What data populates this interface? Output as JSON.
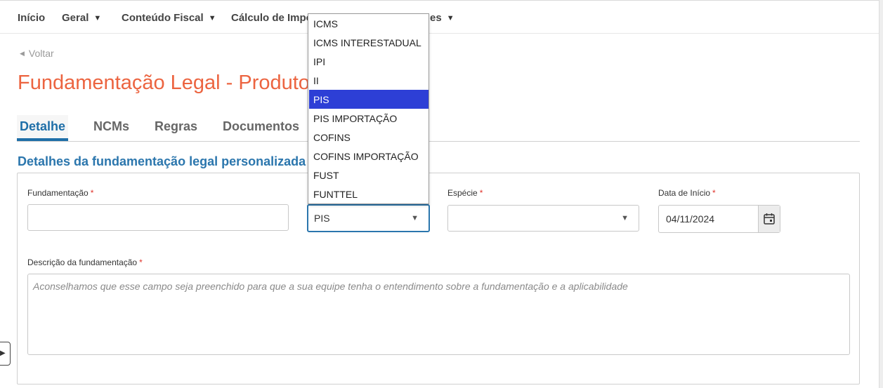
{
  "nav": {
    "items": [
      {
        "label": "Início",
        "caret": false
      },
      {
        "label": "Geral",
        "caret": true
      },
      {
        "label": "Conteúdo Fiscal",
        "caret": true
      },
      {
        "label": "Cálculo de Impos",
        "caret": false
      },
      {
        "label": "es",
        "caret": true
      }
    ]
  },
  "back": {
    "label": "Voltar"
  },
  "page": {
    "title": "Fundamentação Legal - Produto"
  },
  "tabs": [
    {
      "label": "Detalhe",
      "active": true
    },
    {
      "label": "NCMs",
      "active": false
    },
    {
      "label": "Regras",
      "active": false
    },
    {
      "label": "Documentos",
      "active": false
    }
  ],
  "section": {
    "title": "Detalhes da fundamentação legal personalizada"
  },
  "form": {
    "fundamentacao": {
      "label": "Fundamentação",
      "required": "*",
      "value": ""
    },
    "tributo": {
      "value": "PIS"
    },
    "especie": {
      "label": "Espécie",
      "required": "*",
      "value": ""
    },
    "data_inicio": {
      "label": "Data de Início",
      "required": "*",
      "value": "04/11/2024"
    },
    "descricao": {
      "label": "Descrição da fundamentação",
      "required": "*",
      "placeholder": "Aconselhamos que esse campo seja preenchido para que a sua equipe tenha o entendimento sobre a fundamentação e a aplicabilidade"
    }
  },
  "dropdown": {
    "options": [
      "ICMS",
      "ICMS INTERESTADUAL",
      "IPI",
      "II",
      "PIS",
      "PIS IMPORTAÇÃO",
      "COFINS",
      "COFINS IMPORTAÇÃO",
      "FUST",
      "FUNTTEL"
    ],
    "selected_index": 4
  },
  "colors": {
    "title_orange": "#ec6440",
    "accent_blue": "#1f6fa8",
    "selected_option": "#2d3fd6",
    "required_red": "#e0342c"
  },
  "icons": {
    "nav_caret": "caret-down-icon",
    "back": "caret-left-icon",
    "select_arrow": "triangle-down-icon",
    "date": "calendar-icon",
    "sidebar_toggle": "caret-right-icon"
  }
}
